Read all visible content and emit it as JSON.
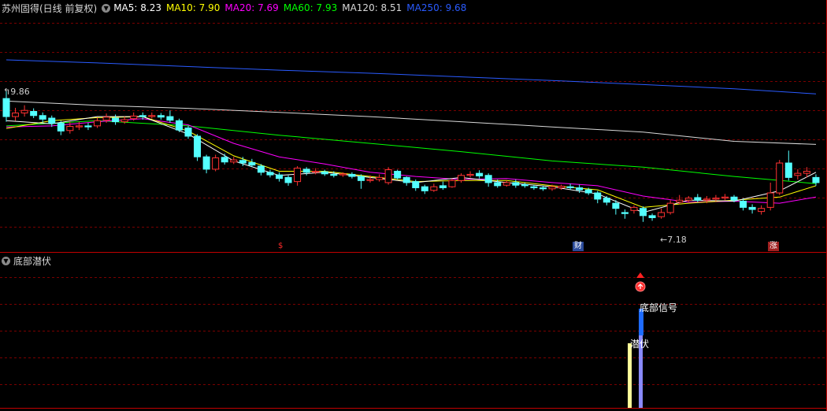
{
  "header": {
    "title": "苏州固得(日线 前复权)",
    "ma": [
      {
        "label": "MA5: 8.23",
        "color": "#ffffff"
      },
      {
        "label": "MA10: 7.90",
        "color": "#ffff00"
      },
      {
        "label": "MA20: 7.69",
        "color": "#ff00ff"
      },
      {
        "label": "MA60: 7.93",
        "color": "#00ff00"
      },
      {
        "label": "MA120: 8.51",
        "color": "#d8d8d8"
      },
      {
        "label": "MA250: 9.68",
        "color": "#2a5bff"
      }
    ]
  },
  "annotations": {
    "high_label": "9.86",
    "low_label": "7.18"
  },
  "event_tags": [
    {
      "label": "$",
      "color": "#ff2a2a",
      "bg": "#000000"
    },
    {
      "label": "财",
      "color": "#ffffff",
      "bg": "#2a4a9a"
    },
    {
      "label": "涨",
      "color": "#ffffff",
      "bg": "#a02020"
    }
  ],
  "indicator": {
    "name": "底部潜伏",
    "signal_label": "底部信号",
    "latent_label": "潜伏"
  },
  "colors": {
    "up": "#ff3232",
    "down": "#54ffff",
    "grid": "#7a0000",
    "separator": "#c00000"
  },
  "candles": [
    [
      9.83,
      9.48,
      9.98,
      9.38
    ],
    [
      9.48,
      9.55,
      9.65,
      9.4
    ],
    [
      9.55,
      9.6,
      9.7,
      9.48
    ],
    [
      9.58,
      9.5,
      9.64,
      9.45
    ],
    [
      9.5,
      9.43,
      9.56,
      9.36
    ],
    [
      9.45,
      9.35,
      9.5,
      9.28
    ],
    [
      9.35,
      9.2,
      9.4,
      9.12
    ],
    [
      9.21,
      9.29,
      9.38,
      9.15
    ],
    [
      9.28,
      9.3,
      9.38,
      9.22
    ],
    [
      9.3,
      9.28,
      9.36,
      9.22
    ],
    [
      9.3,
      9.4,
      9.46,
      9.26
    ],
    [
      9.41,
      9.47,
      9.54,
      9.36
    ],
    [
      9.45,
      9.38,
      9.52,
      9.32
    ],
    [
      9.38,
      9.42,
      9.48,
      9.34
    ],
    [
      9.44,
      9.49,
      9.56,
      9.4
    ],
    [
      9.5,
      9.48,
      9.56,
      9.42
    ],
    [
      9.48,
      9.5,
      9.56,
      9.44
    ],
    [
      9.5,
      9.47,
      9.55,
      9.42
    ],
    [
      9.48,
      9.41,
      9.6,
      9.36
    ],
    [
      9.4,
      9.22,
      9.44,
      9.18
    ],
    [
      9.26,
      9.1,
      9.3,
      9.05
    ],
    [
      9.1,
      8.7,
      9.14,
      8.62
    ],
    [
      8.7,
      8.46,
      8.74,
      8.38
    ],
    [
      8.46,
      8.68,
      8.74,
      8.42
    ],
    [
      8.69,
      8.6,
      8.76,
      8.55
    ],
    [
      8.6,
      8.64,
      8.7,
      8.56
    ],
    [
      8.63,
      8.58,
      8.7,
      8.52
    ],
    [
      8.59,
      8.54,
      8.66,
      8.5
    ],
    [
      8.52,
      8.4,
      8.56,
      8.34
    ],
    [
      8.4,
      8.35,
      8.45,
      8.3
    ],
    [
      8.35,
      8.28,
      8.4,
      8.22
    ],
    [
      8.3,
      8.2,
      8.34,
      8.14
    ],
    [
      8.22,
      8.48,
      8.52,
      8.14
    ],
    [
      8.46,
      8.4,
      8.5,
      8.34
    ],
    [
      8.4,
      8.42,
      8.48,
      8.36
    ],
    [
      8.41,
      8.37,
      8.45,
      8.33
    ],
    [
      8.36,
      8.34,
      8.42,
      8.3
    ],
    [
      8.35,
      8.37,
      8.4,
      8.31
    ],
    [
      8.36,
      8.32,
      8.4,
      8.28
    ],
    [
      8.32,
      8.24,
      8.36,
      8.08
    ],
    [
      8.24,
      8.26,
      8.34,
      8.2
    ],
    [
      8.26,
      8.3,
      8.36,
      8.22
    ],
    [
      8.2,
      8.45,
      8.5,
      8.16
    ],
    [
      8.42,
      8.29,
      8.45,
      8.26
    ],
    [
      8.3,
      8.2,
      8.32,
      8.14
    ],
    [
      8.22,
      8.1,
      8.26,
      8.04
    ],
    [
      8.12,
      8.04,
      8.16,
      7.98
    ],
    [
      8.05,
      8.12,
      8.18,
      8.02
    ],
    [
      8.14,
      8.1,
      8.22,
      8.06
    ],
    [
      8.12,
      8.24,
      8.28,
      8.1
    ],
    [
      8.24,
      8.34,
      8.38,
      8.2
    ],
    [
      8.34,
      8.36,
      8.42,
      8.3
    ],
    [
      8.38,
      8.33,
      8.44,
      8.28
    ],
    [
      8.34,
      8.2,
      8.38,
      8.12
    ],
    [
      8.2,
      8.14,
      8.26,
      8.1
    ],
    [
      8.15,
      8.2,
      8.24,
      8.12
    ],
    [
      8.2,
      8.15,
      8.26,
      8.1
    ],
    [
      8.16,
      8.14,
      8.2,
      8.1
    ],
    [
      8.12,
      8.1,
      8.16,
      8.06
    ],
    [
      8.1,
      8.08,
      8.14,
      8.04
    ],
    [
      8.08,
      8.12,
      8.16,
      8.04
    ],
    [
      8.1,
      8.13,
      8.16,
      8.06
    ],
    [
      8.12,
      8.1,
      8.18,
      8.06
    ],
    [
      8.1,
      8.06,
      8.16,
      8.0
    ],
    [
      8.06,
      8.0,
      8.1,
      7.96
    ],
    [
      8.0,
      7.88,
      8.04,
      7.8
    ],
    [
      7.9,
      7.82,
      7.94,
      7.76
    ],
    [
      7.8,
      7.7,
      7.86,
      7.58
    ],
    [
      7.62,
      7.6,
      7.68,
      7.5
    ],
    [
      7.66,
      7.72,
      7.76,
      7.6
    ],
    [
      7.7,
      7.56,
      7.74,
      7.44
    ],
    [
      7.56,
      7.52,
      7.6,
      7.46
    ],
    [
      7.54,
      7.62,
      7.7,
      7.5
    ],
    [
      7.62,
      7.8,
      7.86,
      7.58
    ],
    [
      7.82,
      7.86,
      7.96,
      7.78
    ],
    [
      7.86,
      7.9,
      7.94,
      7.82
    ],
    [
      7.91,
      7.86,
      7.98,
      7.82
    ],
    [
      7.86,
      7.88,
      7.94,
      7.8
    ],
    [
      7.88,
      7.9,
      7.96,
      7.84
    ],
    [
      7.9,
      7.92,
      7.98,
      7.86
    ],
    [
      7.92,
      7.86,
      7.96,
      7.82
    ],
    [
      7.84,
      7.72,
      7.9,
      7.66
    ],
    [
      7.72,
      7.68,
      7.78,
      7.6
    ],
    [
      7.64,
      7.7,
      7.76,
      7.58
    ],
    [
      7.72,
      8.0,
      8.2,
      7.66
    ],
    [
      8.0,
      8.58,
      8.64,
      7.96
    ],
    [
      8.58,
      8.3,
      8.82,
      8.24
    ],
    [
      8.34,
      8.38,
      8.46,
      8.26
    ],
    [
      8.38,
      8.42,
      8.5,
      8.3
    ],
    [
      8.3,
      8.2,
      8.36,
      8.14
    ]
  ],
  "ma_lines": {
    "ma250": [
      [
        0,
        10.58
      ],
      [
        10,
        10.52
      ],
      [
        20,
        10.45
      ],
      [
        30,
        10.38
      ],
      [
        40,
        10.32
      ],
      [
        50,
        10.25
      ],
      [
        60,
        10.18
      ],
      [
        70,
        10.1
      ],
      [
        80,
        10.02
      ],
      [
        89,
        9.92
      ]
    ],
    "ma120": [
      [
        0,
        9.78
      ],
      [
        10,
        9.7
      ],
      [
        20,
        9.64
      ],
      [
        30,
        9.56
      ],
      [
        40,
        9.48
      ],
      [
        50,
        9.38
      ],
      [
        60,
        9.28
      ],
      [
        70,
        9.18
      ],
      [
        80,
        9.0
      ],
      [
        89,
        8.94
      ]
    ],
    "ma60": [
      [
        0,
        9.3
      ],
      [
        10,
        9.4
      ],
      [
        20,
        9.3
      ],
      [
        30,
        9.12
      ],
      [
        40,
        8.96
      ],
      [
        50,
        8.8
      ],
      [
        60,
        8.62
      ],
      [
        70,
        8.5
      ],
      [
        80,
        8.32
      ],
      [
        89,
        8.18
      ]
    ],
    "ma20": [
      [
        0,
        9.28
      ],
      [
        5,
        9.3
      ],
      [
        10,
        9.38
      ],
      [
        15,
        9.44
      ],
      [
        20,
        9.32
      ],
      [
        25,
        8.96
      ],
      [
        30,
        8.7
      ],
      [
        35,
        8.56
      ],
      [
        40,
        8.4
      ],
      [
        45,
        8.32
      ],
      [
        50,
        8.26
      ],
      [
        55,
        8.28
      ],
      [
        60,
        8.2
      ],
      [
        65,
        8.14
      ],
      [
        70,
        7.94
      ],
      [
        75,
        7.82
      ],
      [
        80,
        7.84
      ],
      [
        85,
        7.8
      ],
      [
        89,
        7.92
      ]
    ],
    "ma10": [
      [
        0,
        9.25
      ],
      [
        5,
        9.4
      ],
      [
        10,
        9.46
      ],
      [
        15,
        9.48
      ],
      [
        20,
        9.2
      ],
      [
        25,
        8.72
      ],
      [
        30,
        8.42
      ],
      [
        35,
        8.42
      ],
      [
        40,
        8.32
      ],
      [
        45,
        8.22
      ],
      [
        50,
        8.24
      ],
      [
        55,
        8.24
      ],
      [
        60,
        8.14
      ],
      [
        65,
        8.06
      ],
      [
        70,
        7.72
      ],
      [
        75,
        7.8
      ],
      [
        80,
        7.86
      ],
      [
        85,
        7.92
      ],
      [
        89,
        8.14
      ]
    ],
    "ma5": [
      [
        0,
        9.4
      ],
      [
        5,
        9.34
      ],
      [
        10,
        9.48
      ],
      [
        15,
        9.48
      ],
      [
        20,
        9.14
      ],
      [
        25,
        8.62
      ],
      [
        30,
        8.34
      ],
      [
        35,
        8.4
      ],
      [
        40,
        8.3
      ],
      [
        45,
        8.2
      ],
      [
        50,
        8.3
      ],
      [
        55,
        8.2
      ],
      [
        60,
        8.12
      ],
      [
        65,
        7.98
      ],
      [
        70,
        7.62
      ],
      [
        75,
        7.86
      ],
      [
        80,
        7.84
      ],
      [
        85,
        8.04
      ],
      [
        89,
        8.4
      ]
    ]
  }
}
